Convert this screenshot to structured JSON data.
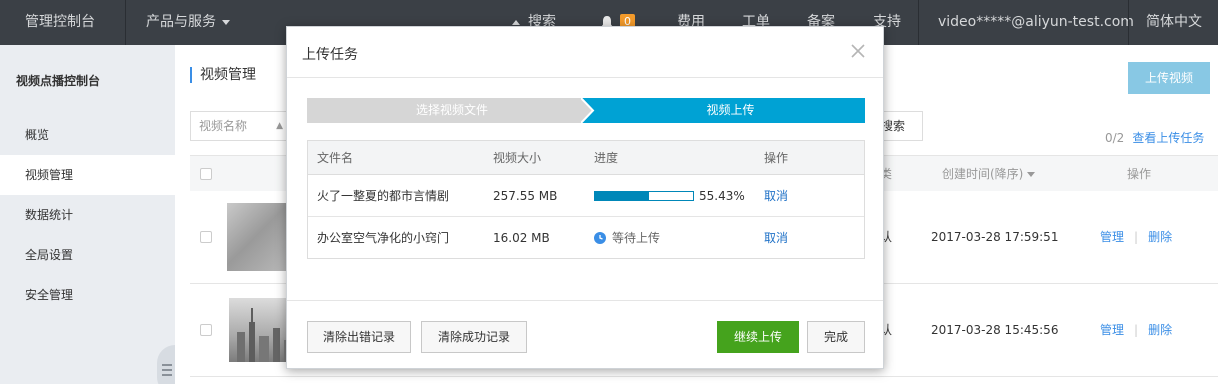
{
  "topbar": {
    "console": "管理控制台",
    "products": "产品与服务",
    "search": "搜索",
    "bell_count": "0",
    "billing": "费用",
    "tickets": "工单",
    "icp": "备案",
    "support": "支持",
    "account": "video*****@aliyun-test.com",
    "language": "简体中文"
  },
  "sidebar": {
    "title": "视频点播控制台",
    "items": [
      {
        "label": "概览"
      },
      {
        "label": "视频管理"
      },
      {
        "label": "数据统计"
      },
      {
        "label": "全局设置"
      },
      {
        "label": "安全管理"
      }
    ]
  },
  "main": {
    "title": "视频管理",
    "upload_button": "上传视频",
    "filter_select": "视频名称",
    "search_button": "搜索",
    "upload_counter": "0/2",
    "view_upload_tasks": "查看上传任务",
    "columns": {
      "category": "类",
      "created": "创建时间(降序)",
      "actions": "操作"
    },
    "rows": [
      {
        "category": "认",
        "created": "2017-03-28 17:59:51",
        "manage": "管理",
        "delete": "删除"
      },
      {
        "category": "认",
        "created": "2017-03-28 15:45:56",
        "manage": "管理",
        "delete": "删除"
      }
    ]
  },
  "modal": {
    "title": "上传任务",
    "steps": {
      "step1": "选择视频文件",
      "step2": "视频上传"
    },
    "table": {
      "headers": {
        "name": "文件名",
        "size": "视频大小",
        "progress": "进度",
        "action": "操作"
      },
      "rows": [
        {
          "name": "火了一整夏的都市言情剧",
          "size": "257.55 MB",
          "progress_pct": "55.43%",
          "progress_fraction": 0.5543,
          "action": "取消"
        },
        {
          "name": "办公室空气净化的小窍门",
          "size": "16.02 MB",
          "status": "等待上传",
          "action": "取消"
        }
      ]
    },
    "buttons": {
      "clear_errors": "清除出错记录",
      "clear_success": "清除成功记录",
      "continue": "继续上传",
      "done": "完成"
    }
  },
  "colors": {
    "topbar": "#3b4046",
    "accent": "#00a2d4",
    "progress": "#0087b8",
    "green": "#45a31d",
    "link": "#3a8ee6"
  }
}
